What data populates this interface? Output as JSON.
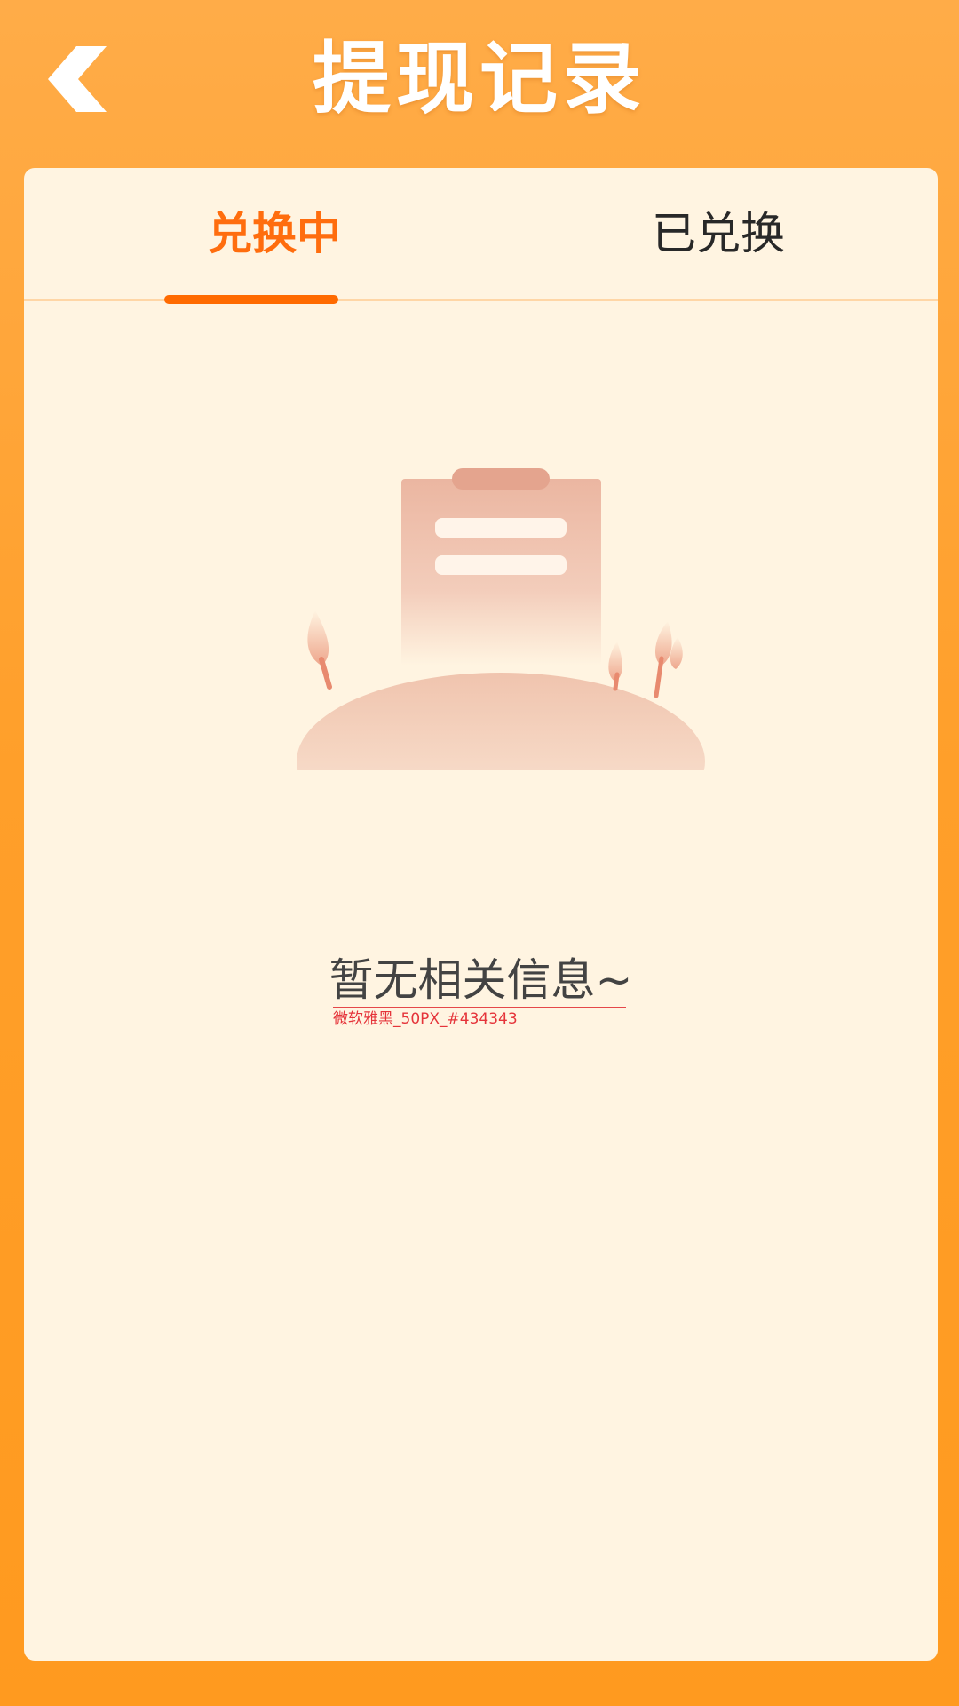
{
  "header": {
    "title": "提现记录",
    "back_icon": "chevron-left-icon"
  },
  "tabs": [
    {
      "label": "兑换中",
      "active": true
    },
    {
      "label": "已兑换",
      "active": false
    }
  ],
  "empty_state": {
    "illustration": "empty-clipboard-illustration",
    "message": "暂无相关信息~",
    "spec_note": "微软雅黑_50PX_#434343"
  },
  "colors": {
    "header_gradient_top": "#ffac48",
    "header_gradient_bottom": "#ff9a1f",
    "card_background": "#fff4e1",
    "tab_active": "#ff6d0e",
    "tab_inactive": "#282828",
    "indicator": "#ff6a00",
    "empty_text": "#434343",
    "spec_note": "#e5343a"
  }
}
